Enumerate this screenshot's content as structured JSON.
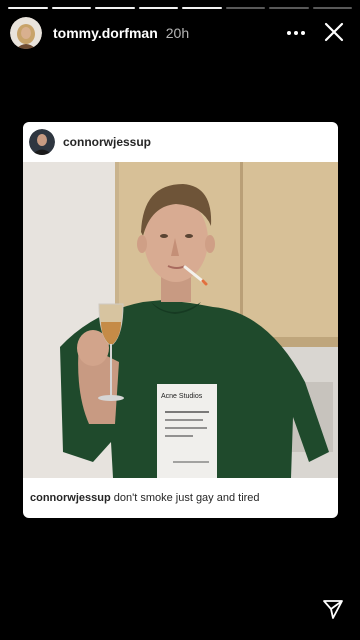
{
  "story": {
    "segments": [
      "done",
      "done",
      "done",
      "done",
      "done",
      "pending",
      "pending",
      "pending"
    ],
    "username": "tommy.dorfman",
    "time": "20h"
  },
  "post": {
    "username": "connorwjessup",
    "caption_user": "connorwjessup",
    "caption_text": "don't smoke just gay and tired",
    "shirt_label": "Acne Studios"
  },
  "icons": {
    "more": "more-dots-icon",
    "close": "close-icon",
    "send": "send-icon"
  }
}
